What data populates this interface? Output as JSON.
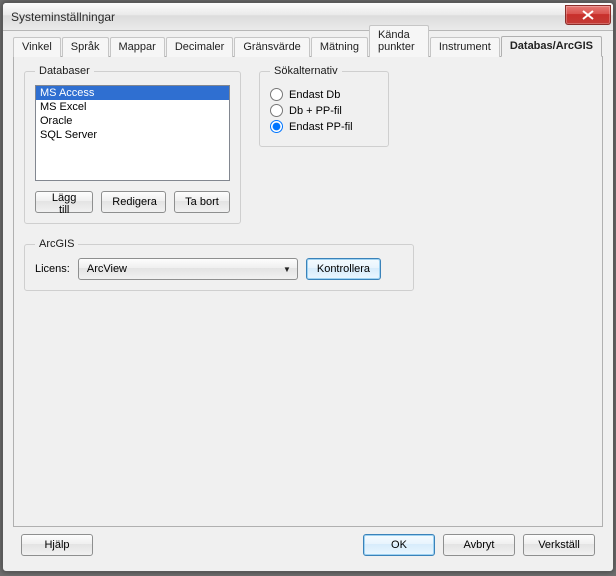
{
  "window": {
    "title": "Systeminställningar"
  },
  "tabs": [
    {
      "label": "Vinkel",
      "active": false
    },
    {
      "label": "Språk",
      "active": false
    },
    {
      "label": "Mappar",
      "active": false
    },
    {
      "label": "Decimaler",
      "active": false
    },
    {
      "label": "Gränsvärde",
      "active": false
    },
    {
      "label": "Mätning",
      "active": false
    },
    {
      "label": "Kända punkter",
      "active": false
    },
    {
      "label": "Instrument",
      "active": false
    },
    {
      "label": "Databas/ArcGIS",
      "active": true
    }
  ],
  "databaser": {
    "legend": "Databaser",
    "items": [
      {
        "label": "MS Access",
        "selected": true
      },
      {
        "label": "MS Excel",
        "selected": false
      },
      {
        "label": "Oracle",
        "selected": false
      },
      {
        "label": "SQL Server",
        "selected": false
      }
    ],
    "buttons": {
      "add": "Lägg till",
      "edit": "Redigera",
      "remove": "Ta bort"
    }
  },
  "sokalternativ": {
    "legend": "Sökalternativ",
    "options": [
      {
        "label": "Endast Db",
        "checked": false
      },
      {
        "label": "Db + PP-fil",
        "checked": false
      },
      {
        "label": "Endast PP-fil",
        "checked": true
      }
    ]
  },
  "arcgis": {
    "legend": "ArcGIS",
    "licens_label": "Licens:",
    "licens_value": "ArcView",
    "check_label": "Kontrollera"
  },
  "footer": {
    "help": "Hjälp",
    "ok": "OK",
    "cancel": "Avbryt",
    "apply": "Verkställ"
  }
}
